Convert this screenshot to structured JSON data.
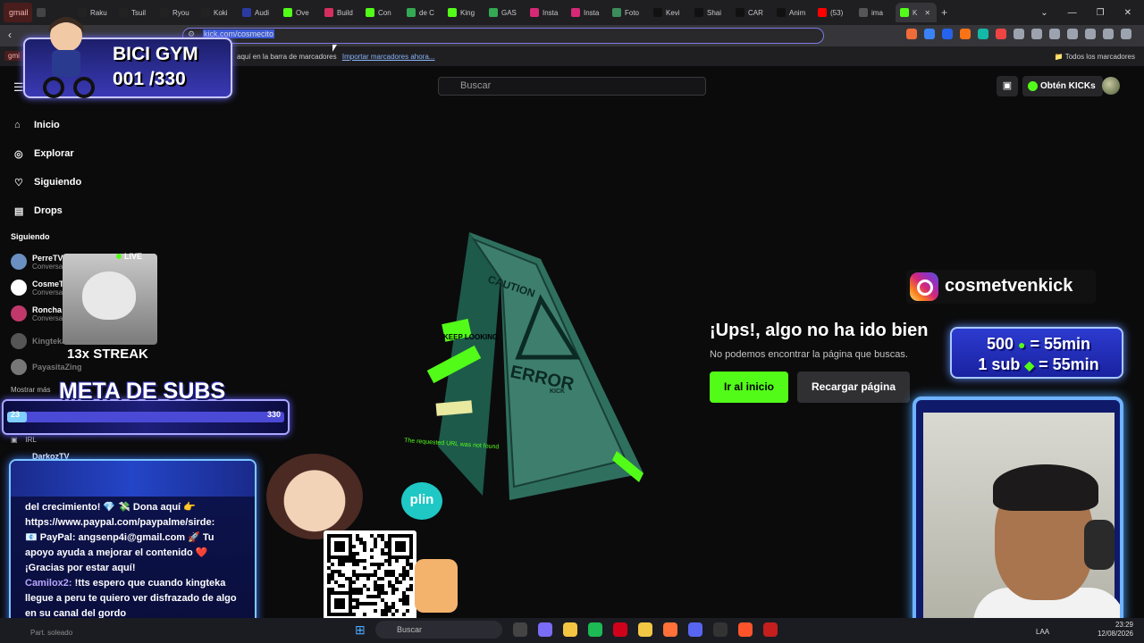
{
  "browser": {
    "tabs": [
      {
        "label": "gmail",
        "color": "#c5221f"
      },
      {
        "label": "",
        "color": "#444444"
      },
      {
        "label": "Raku",
        "color": "#222222"
      },
      {
        "label": "Tsuil",
        "color": "#222222"
      },
      {
        "label": "Ryou",
        "color": "#222222"
      },
      {
        "label": "Koki",
        "color": "#222222"
      },
      {
        "label": "Audi",
        "color": "#2a3aa0"
      },
      {
        "label": "Ove",
        "color": "#53fc18"
      },
      {
        "label": "Build",
        "color": "#d62f5f"
      },
      {
        "label": "Con",
        "color": "#53fc18"
      },
      {
        "label": "de C",
        "color": "#34a853"
      },
      {
        "label": "King",
        "color": "#53fc18"
      },
      {
        "label": "GAS",
        "color": "#34a853"
      },
      {
        "label": "Insta",
        "color": "#d62976"
      },
      {
        "label": "Insta",
        "color": "#d62976"
      },
      {
        "label": "Foto",
        "color": "#3c8d5b"
      },
      {
        "label": "Kevi",
        "color": "#111111"
      },
      {
        "label": "Shai",
        "color": "#111111"
      },
      {
        "label": "CAR",
        "color": "#111111"
      },
      {
        "label": "Anim",
        "color": "#111111"
      },
      {
        "label": "(53)",
        "color": "#ff0000"
      },
      {
        "label": "ima",
        "color": "#555555"
      },
      {
        "label": "K",
        "color": "#53fc18",
        "active": true
      }
    ],
    "new_tab_glyph": "+",
    "url": "kick.com/cosmecito",
    "bookmarks_hint": "aquí en la barra de marcadores",
    "bookmarks_import_link": "Importar marcadores ahora...",
    "bookmarks_all": "Todos los marcadores",
    "gmail_mini": "gmi"
  },
  "kick": {
    "search_placeholder": "Buscar",
    "get_kicks": "Obtén KICKs",
    "nav": [
      {
        "label": "Inicio",
        "icon": "home-icon",
        "glyph": "⌂"
      },
      {
        "label": "Explorar",
        "icon": "compass-icon",
        "glyph": "◎"
      },
      {
        "label": "Siguiendo",
        "icon": "heart-icon",
        "glyph": "♡"
      },
      {
        "label": "Drops",
        "icon": "drops-icon",
        "glyph": "▤"
      }
    ],
    "following_heading": "Siguiendo",
    "following": [
      {
        "name": "PerreTV",
        "sub": "Conversa",
        "color": "#6a8fc0"
      },
      {
        "name": "CosmeT",
        "sub": "Conversa",
        "color": "#ffffff"
      },
      {
        "name": "Roncha",
        "sub": "Conversa",
        "color": "#c0396a"
      },
      {
        "name": "Kingteka",
        "sub": "",
        "color": "#555555",
        "offline": true
      },
      {
        "name": "PayasitaZing",
        "sub": "",
        "color": "#777777",
        "offline": true
      }
    ],
    "show_more": "Mostrar más",
    "irl": "IRL",
    "darkoz": "DarkozTV",
    "error_title": "¡Ups!, algo no ha ido bien",
    "error_subtitle": "No podemos encontrar la página que buscas.",
    "home_button": "Ir al inicio",
    "reload_button": "Recargar página",
    "sign_text": [
      "CAUTION",
      "ERROR",
      "KICK",
      "KEEP LOOKING",
      "The requested URL was not found"
    ]
  },
  "overlays": {
    "bici_gym_title": "BICI GYM",
    "bici_gym_count": "001 /330",
    "live_label": "LIVE",
    "streak": "13x STREAK",
    "meta_title": "META DE SUBS",
    "meta_current": "23",
    "meta_goal": "330",
    "meta_progress": 0.07,
    "chat_lines": [
      {
        "user": "",
        "text": "del crecimiento! 💎 💸 Dona aquí 👉"
      },
      {
        "user": "",
        "text": "https://www.paypal.com/paypalme/sirde:"
      },
      {
        "user": "",
        "text": "📧 PayPal: angsenp4i@gmail.com 🚀 Tu"
      },
      {
        "user": "",
        "text": "apoyo ayuda a mejorar el contenido ❤️"
      },
      {
        "user": "",
        "text": "¡Gracias por estar aquí!"
      },
      {
        "user": "Camilox2:",
        "text": " !tts espero que cuando kingteka llegue a peru te quiero ver disfrazado de algo en su canal del gordo"
      }
    ],
    "plin_label": "plin",
    "instagram_handle": "cosmetvenkick",
    "subs_line1_left": "500",
    "subs_line1_right": "= 55min",
    "subs_line2_left": "1 sub",
    "subs_line2_right": "= 55min"
  },
  "taskbar": {
    "search_placeholder": "Buscar",
    "lang": "LAA",
    "time": "23:29",
    "date": "12/08/2026",
    "status": "Part. soleado"
  },
  "colors": {
    "kick_green": "#53fc18",
    "accent_purple": "#7e79e6"
  }
}
